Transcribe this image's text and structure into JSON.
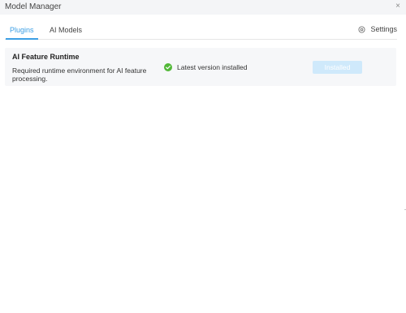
{
  "window": {
    "title": "Model Manager",
    "close_symbol": "×"
  },
  "tabs": [
    {
      "label": "Plugins",
      "active": true
    },
    {
      "label": "AI Models",
      "active": false
    }
  ],
  "settings": {
    "label": "Settings",
    "icon": "gear-icon"
  },
  "plugin": {
    "name": "AI Feature Runtime",
    "description": "Required runtime environment for AI feature processing.",
    "status_text": "Latest version installed",
    "status_icon": "check-circle-icon",
    "button_label": "Installed"
  },
  "colors": {
    "accent": "#3b9ee4",
    "success": "#52b838",
    "button_disabled": "#cfe9fb"
  }
}
